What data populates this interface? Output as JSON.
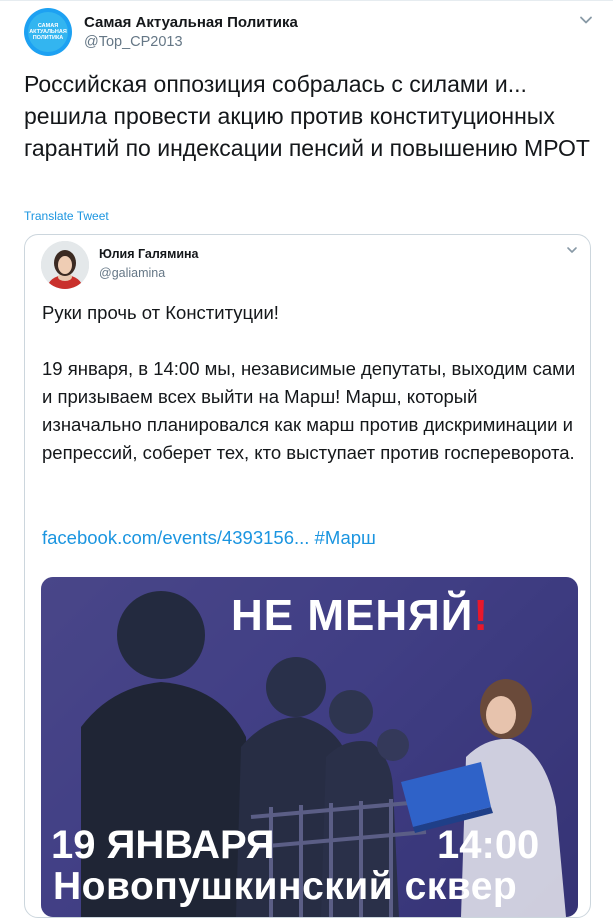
{
  "tweet": {
    "author_name": "Самая Актуальная Политика",
    "author_handle": "@Top_CP2013",
    "avatar_text": "САМАЯ АКТУАЛЬНАЯ ПОЛИТИКА",
    "text": "Российская оппозиция собралась с силами и... решила провести акцию против конституционных гарантий по индексации пенсий и повышению МРОТ",
    "translate_label": "Translate Tweet",
    "menu_icon": "chevron-down-icon"
  },
  "quote": {
    "author_name": "Юлия Галямина",
    "author_handle": "@galiamina",
    "paragraph1": "Руки прочь от Конституции!",
    "paragraph2": "19 января, в 14:00 мы, независимые депутаты, выходим сами и призываем всех выйти на Марш! Марш, который изначально планировался как марш против дискриминации и репрессий, соберет тех, кто выступает против госпереворота.",
    "link": "facebook.com/events/4393156... #Марш",
    "menu_icon": "chevron-down-icon",
    "image": {
      "headline": "НЕ МЕНЯЙ",
      "headline_mark": "!",
      "date": "19 ЯНВАРЯ",
      "time": "14:00",
      "place": "Новопушкинский сквер"
    }
  },
  "colors": {
    "link": "#1b95e0",
    "secondary_text": "#657786",
    "border": "#ccd6dd",
    "accent_red": "#e8182b"
  }
}
